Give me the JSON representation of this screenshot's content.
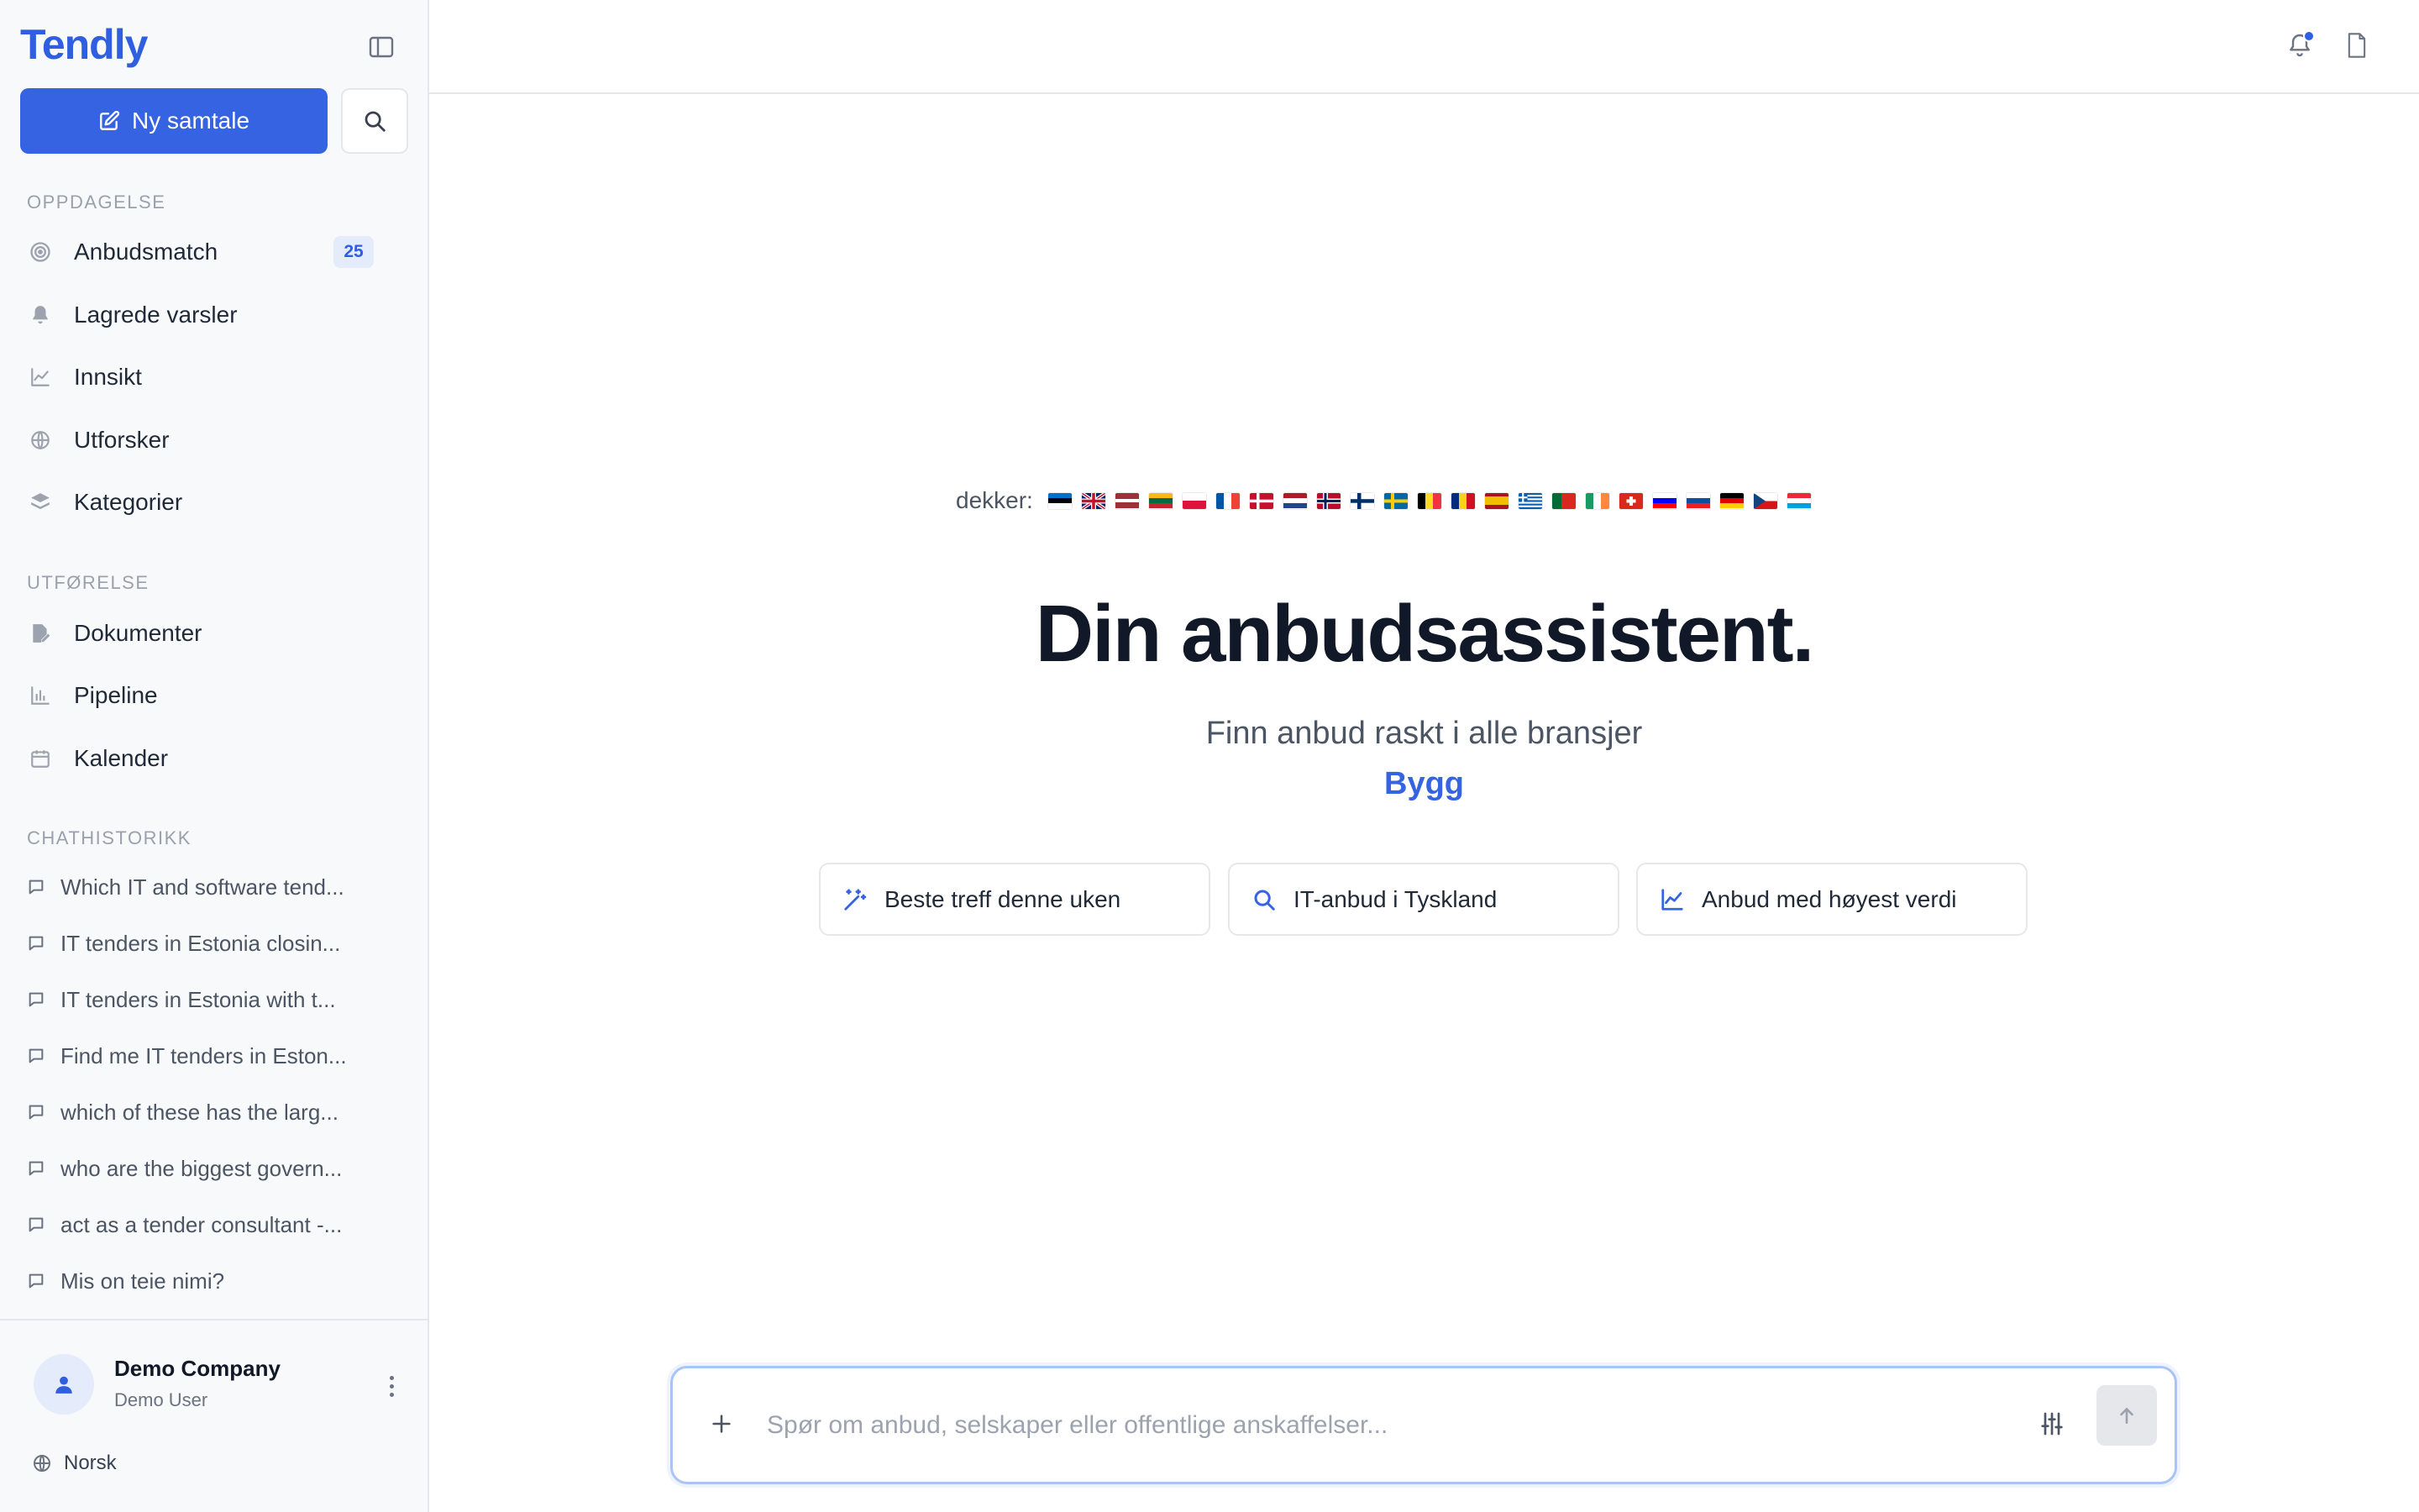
{
  "app": {
    "logo": "Tendly"
  },
  "sidebar": {
    "new_chat_label": "Ny samtale",
    "sections": {
      "discovery": "OPPDAGELSE",
      "execution": "UTFØRELSE",
      "history": "CHATHISTORIKK"
    },
    "discovery_items": [
      {
        "label": "Anbudsmatch",
        "icon": "target-icon",
        "badge": "25"
      },
      {
        "label": "Lagrede varsler",
        "icon": "bell-icon"
      },
      {
        "label": "Innsikt",
        "icon": "line-chart-icon"
      },
      {
        "label": "Utforsker",
        "icon": "globe-icon"
      },
      {
        "label": "Kategorier",
        "icon": "layers-icon"
      }
    ],
    "execution_items": [
      {
        "label": "Dokumenter",
        "icon": "document-edit-icon"
      },
      {
        "label": "Pipeline",
        "icon": "bar-chart-icon"
      },
      {
        "label": "Kalender",
        "icon": "calendar-icon"
      }
    ],
    "history_items": [
      "Which IT and software tend...",
      "IT tenders in Estonia closin...",
      "IT tenders in Estonia with t...",
      "Find me IT tenders in Eston...",
      "which of these has the larg...",
      "who are the biggest govern...",
      "act as a tender consultant -...",
      "Mis on teie nimi?"
    ],
    "user": {
      "company": "Demo Company",
      "name": "Demo User"
    },
    "language": "Norsk"
  },
  "main": {
    "covers_label": "dekker:",
    "flags": [
      "EE",
      "GB",
      "LV",
      "LT",
      "PL",
      "FR",
      "DK",
      "NL",
      "NO",
      "FI",
      "SE",
      "BE",
      "RO",
      "ES",
      "GR",
      "PT",
      "IE",
      "CH",
      "SI",
      "SK",
      "DE",
      "CZ",
      "LU"
    ],
    "headline": "Din anbudsassistent.",
    "subline": "Finn anbud raskt i alle bransjer",
    "rotating_word": "Bygg",
    "chips": [
      {
        "label": "Beste treff denne uken",
        "icon": "magic-wand-icon"
      },
      {
        "label": "IT-anbud i Tyskland",
        "icon": "search-icon"
      },
      {
        "label": "Anbud med høyest verdi",
        "icon": "line-chart-icon"
      }
    ],
    "composer": {
      "placeholder": "Spør om anbud, selskaper eller offentlige anskaffelser...",
      "value": ""
    }
  },
  "colors": {
    "accent": "#3563e2",
    "sidebar_bg": "#f8f9fb",
    "badge_bg": "#e4ebfb"
  }
}
